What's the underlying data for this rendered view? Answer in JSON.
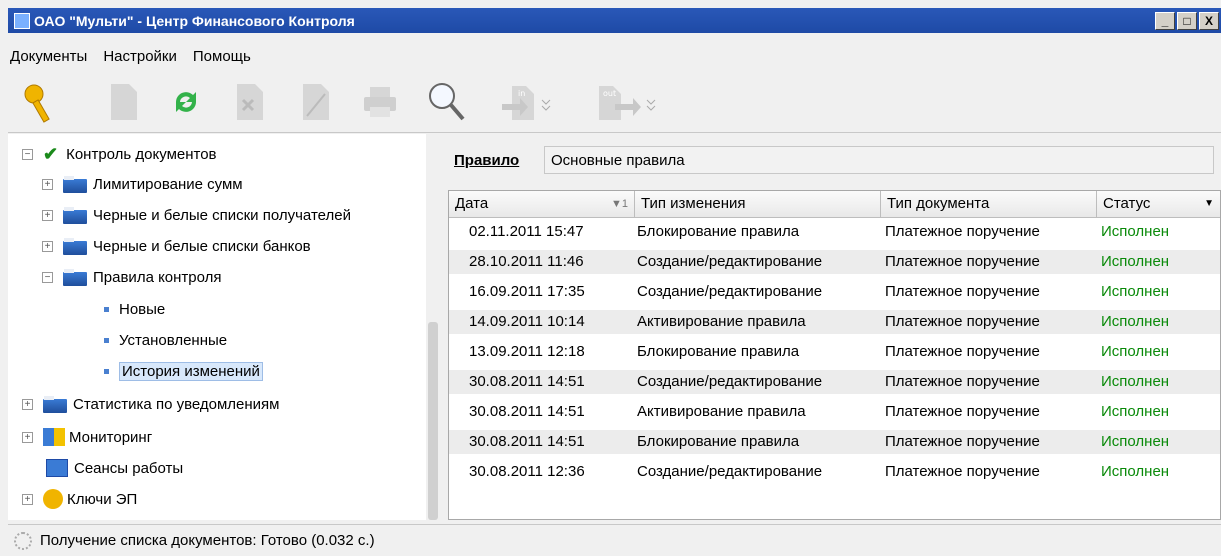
{
  "window": {
    "title": "ОАО \"Мульти\" - Центр Финансового Контроля",
    "buttons": [
      "_",
      "□",
      "X"
    ]
  },
  "menu": [
    "Документы",
    "Настройки",
    "Помощь"
  ],
  "toolbar": {
    "icons": [
      "keys-icon",
      "document-icon",
      "refresh-icon",
      "delete-document-icon",
      "sign-document-icon",
      "print-icon",
      "search-icon",
      "import-icon",
      "export-icon"
    ],
    "import_label": "in",
    "export_label": "out"
  },
  "tree": {
    "root": "Контроль документов",
    "items": [
      "Лимитирование сумм",
      "Черные и белые списки получателей",
      "Черные и белые списки банков",
      "Правила контроля",
      "Новые",
      "Установленные",
      "История изменений",
      "Статистика по уведомлениям",
      "Мониторинг",
      "Сеансы работы",
      "Ключи ЭП"
    ]
  },
  "rule": {
    "label": "Правило",
    "value": "Основные правила"
  },
  "table": {
    "columns": [
      "Дата",
      "Тип изменения",
      "Тип документа",
      "Статус"
    ],
    "sort_indicator": "▼1",
    "rows": [
      [
        "02.11.2011 15:47",
        "Блокирование правила",
        "Платежное поручение",
        "Исполнен"
      ],
      [
        "28.10.2011 11:46",
        "Создание/редактирование",
        "Платежное поручение",
        "Исполнен"
      ],
      [
        "16.09.2011 17:35",
        "Создание/редактирование",
        "Платежное поручение",
        "Исполнен"
      ],
      [
        "14.09.2011 10:14",
        "Активирование правила",
        "Платежное поручение",
        "Исполнен"
      ],
      [
        "13.09.2011 12:18",
        "Блокирование правила",
        "Платежное поручение",
        "Исполнен"
      ],
      [
        "30.08.2011 14:51",
        "Создание/редактирование",
        "Платежное поручение",
        "Исполнен"
      ],
      [
        "30.08.2011 14:51",
        "Активирование правила",
        "Платежное поручение",
        "Исполнен"
      ],
      [
        "30.08.2011 14:51",
        "Блокирование правила",
        "Платежное поручение",
        "Исполнен"
      ],
      [
        "30.08.2011 12:36",
        "Создание/редактирование",
        "Платежное поручение",
        "Исполнен"
      ]
    ]
  },
  "status_bar": "Получение списка документов: Готово (0.032 с.)",
  "colors": {
    "title_bar": "#2a58b8",
    "status_ok": "#0a8a0a",
    "selection": "#d8e8fb"
  }
}
